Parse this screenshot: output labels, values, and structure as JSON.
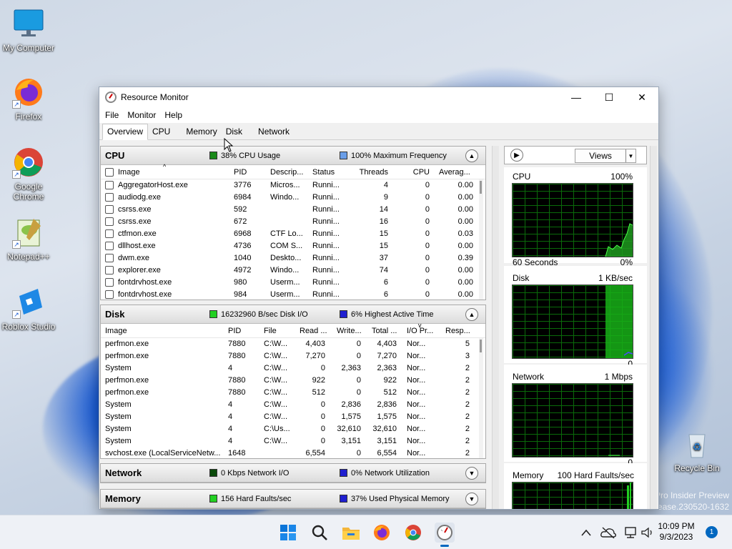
{
  "colors": {
    "accent": "#0067c0",
    "graph_green": "#00c000",
    "cpu_green": "#1a8a1a",
    "blue_meter": "#1f1fd0"
  },
  "desktop": {
    "icons": [
      {
        "label": "My Computer",
        "icon": "monitor-icon"
      },
      {
        "label": "Firefox",
        "icon": "firefox-icon"
      },
      {
        "label": "Google Chrome",
        "icon": "chrome-icon"
      },
      {
        "label": "Notepad++",
        "icon": "notepadpp-icon"
      },
      {
        "label": "Roblox Studio",
        "icon": "roblox-studio-icon"
      },
      {
        "label": "Recycle Bin",
        "icon": "recycle-bin-icon"
      }
    ],
    "watermark": {
      "line1": "Pro Insider Preview",
      "line2": "lease.230520-1632"
    }
  },
  "window": {
    "title": "Resource Monitor",
    "controls": {
      "minimize": "—",
      "maximize": "☐",
      "close": "✕"
    },
    "menu": [
      "File",
      "Monitor",
      "Help"
    ],
    "tabs": [
      "Overview",
      "CPU",
      "Memory",
      "Disk",
      "Network"
    ],
    "active_tab": "Overview"
  },
  "cpu": {
    "title": "CPU",
    "metric1": "38% CPU Usage",
    "metric2": "100% Maximum Frequency",
    "columns": [
      "Image",
      "PID",
      "Descrip...",
      "Status",
      "Threads",
      "CPU",
      "Averag..."
    ],
    "rows": [
      [
        "AggregatorHost.exe",
        "3776",
        "Micros...",
        "Runni...",
        "4",
        "0",
        "0.00"
      ],
      [
        "audiodg.exe",
        "6984",
        "Windo...",
        "Runni...",
        "9",
        "0",
        "0.00"
      ],
      [
        "csrss.exe",
        "592",
        "",
        "Runni...",
        "14",
        "0",
        "0.00"
      ],
      [
        "csrss.exe",
        "672",
        "",
        "Runni...",
        "16",
        "0",
        "0.00"
      ],
      [
        "ctfmon.exe",
        "6968",
        "CTF Lo...",
        "Runni...",
        "15",
        "0",
        "0.03"
      ],
      [
        "dllhost.exe",
        "4736",
        "COM S...",
        "Runni...",
        "15",
        "0",
        "0.00"
      ],
      [
        "dwm.exe",
        "1040",
        "Deskto...",
        "Runni...",
        "37",
        "0",
        "0.39"
      ],
      [
        "explorer.exe",
        "4972",
        "Windo...",
        "Runni...",
        "74",
        "0",
        "0.00"
      ],
      [
        "fontdrvhost.exe",
        "980",
        "Userm...",
        "Runni...",
        "6",
        "0",
        "0.00"
      ],
      [
        "fontdrvhost.exe",
        "984",
        "Userm...",
        "Runni...",
        "6",
        "0",
        "0.00"
      ]
    ]
  },
  "disk": {
    "title": "Disk",
    "metric1": "16232960 B/sec Disk I/O",
    "metric2": "6% Highest Active Time",
    "columns": [
      "Image",
      "PID",
      "File",
      "Read ...",
      "Write...",
      "Total ...",
      "I/O Pr...",
      "Resp..."
    ],
    "rows": [
      [
        "perfmon.exe",
        "7880",
        "C:\\W...",
        "4,403",
        "0",
        "4,403",
        "Nor...",
        "5"
      ],
      [
        "perfmon.exe",
        "7880",
        "C:\\W...",
        "7,270",
        "0",
        "7,270",
        "Nor...",
        "3"
      ],
      [
        "System",
        "4",
        "C:\\W...",
        "0",
        "2,363",
        "2,363",
        "Nor...",
        "2"
      ],
      [
        "perfmon.exe",
        "7880",
        "C:\\W...",
        "922",
        "0",
        "922",
        "Nor...",
        "2"
      ],
      [
        "perfmon.exe",
        "7880",
        "C:\\W...",
        "512",
        "0",
        "512",
        "Nor...",
        "2"
      ],
      [
        "System",
        "4",
        "C:\\W...",
        "0",
        "2,836",
        "2,836",
        "Nor...",
        "2"
      ],
      [
        "System",
        "4",
        "C:\\W...",
        "0",
        "1,575",
        "1,575",
        "Nor...",
        "2"
      ],
      [
        "System",
        "4",
        "C:\\Us...",
        "0",
        "32,610",
        "32,610",
        "Nor...",
        "2"
      ],
      [
        "System",
        "4",
        "C:\\W...",
        "0",
        "3,151",
        "3,151",
        "Nor...",
        "2"
      ],
      [
        "svchost.exe (LocalServiceNetw...",
        "1648",
        "",
        "6,554",
        "0",
        "6,554",
        "Nor...",
        "2"
      ]
    ]
  },
  "network": {
    "title": "Network",
    "metric1": "0 Kbps Network I/O",
    "metric2": "0% Network Utilization"
  },
  "memory": {
    "title": "Memory",
    "metric1": "156 Hard Faults/sec",
    "metric2": "37% Used Physical Memory"
  },
  "right": {
    "views_label": "Views",
    "graphs": [
      {
        "name": "CPU",
        "max": "100%",
        "footer_left": "60 Seconds",
        "footer_right": "0%"
      },
      {
        "name": "Disk",
        "max": "1 KB/sec",
        "footer_left": "",
        "footer_right": "0"
      },
      {
        "name": "Network",
        "max": "1 Mbps",
        "footer_left": "",
        "footer_right": "0"
      },
      {
        "name": "Memory",
        "max": "100 Hard Faults/sec",
        "footer_left": "",
        "footer_right": ""
      }
    ]
  },
  "taskbar": {
    "apps": [
      "start-icon",
      "search-icon",
      "file-explorer-icon",
      "firefox-icon",
      "chrome-icon",
      "resource-monitor-icon"
    ],
    "time": "10:09 PM",
    "date": "9/3/2023",
    "notification_count": "1"
  }
}
